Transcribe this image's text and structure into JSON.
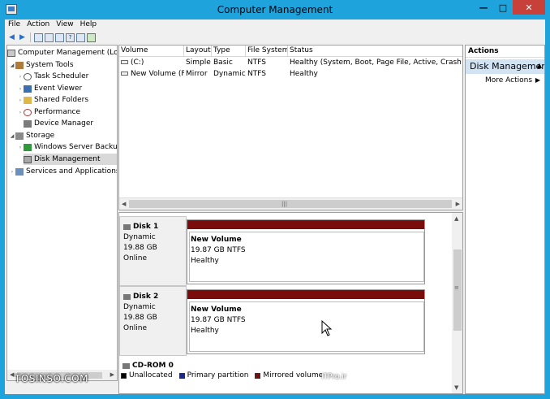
{
  "window": {
    "title": "Computer Management",
    "controls": {
      "minimize": "—",
      "maximize": "□",
      "close": "✕"
    }
  },
  "menu": [
    "File",
    "Action",
    "View",
    "Help"
  ],
  "toolbar": [
    "back-arrow-icon",
    "forward-arrow-icon",
    "up-folder-icon",
    "show-tree-icon",
    "properties-icon",
    "help-icon",
    "view-icon",
    "export-icon"
  ],
  "tree": {
    "root": "Computer Management (Local)",
    "system_tools": "System Tools",
    "task_scheduler": "Task Scheduler",
    "event_viewer": "Event Viewer",
    "shared_folders": "Shared Folders",
    "performance": "Performance",
    "device_manager": "Device Manager",
    "storage": "Storage",
    "windows_server_backup": "Windows Server Backup",
    "disk_management": "Disk Management",
    "services_and_applications": "Services and Applications"
  },
  "volumes": {
    "columns": [
      "Volume",
      "Layout",
      "Type",
      "File System",
      "Status"
    ],
    "rows": [
      {
        "volume": "(C:)",
        "layout": "Simple",
        "type": "Basic",
        "fs": "NTFS",
        "status": "Healthy (System, Boot, Page File, Active, Crash Dump"
      },
      {
        "volume": "New Volume (F:)",
        "layout": "Mirror",
        "type": "Dynamic",
        "fs": "NTFS",
        "status": "Healthy"
      }
    ]
  },
  "disks": [
    {
      "name": "Disk 1",
      "kind": "Dynamic",
      "size": "19.88 GB",
      "state": "Online",
      "part_name": "New Volume",
      "part_size": "19.87 GB NTFS",
      "part_status": "Healthy"
    },
    {
      "name": "Disk 2",
      "kind": "Dynamic",
      "size": "19.88 GB",
      "state": "Online",
      "part_name": "New Volume",
      "part_size": "19.87 GB NTFS",
      "part_status": "Healthy"
    }
  ],
  "cdrom": {
    "name": "CD-ROM 0"
  },
  "legend": [
    {
      "label": "Unallocated",
      "color": "#000000"
    },
    {
      "label": "Primary partition",
      "color": "#1a2a8a"
    },
    {
      "label": "Mirrored volume",
      "color": "#7a0c0c"
    }
  ],
  "actions": {
    "header": "Actions",
    "section": "Disk Management",
    "more": "More Actions"
  },
  "watermark": {
    "left": "TOSINSO.COM",
    "right": "ITPro.ir"
  },
  "colors": {
    "titlebar": "#1fa3dc",
    "mirrored": "#7a0c0c",
    "selected_action": "#d2e4f4"
  }
}
